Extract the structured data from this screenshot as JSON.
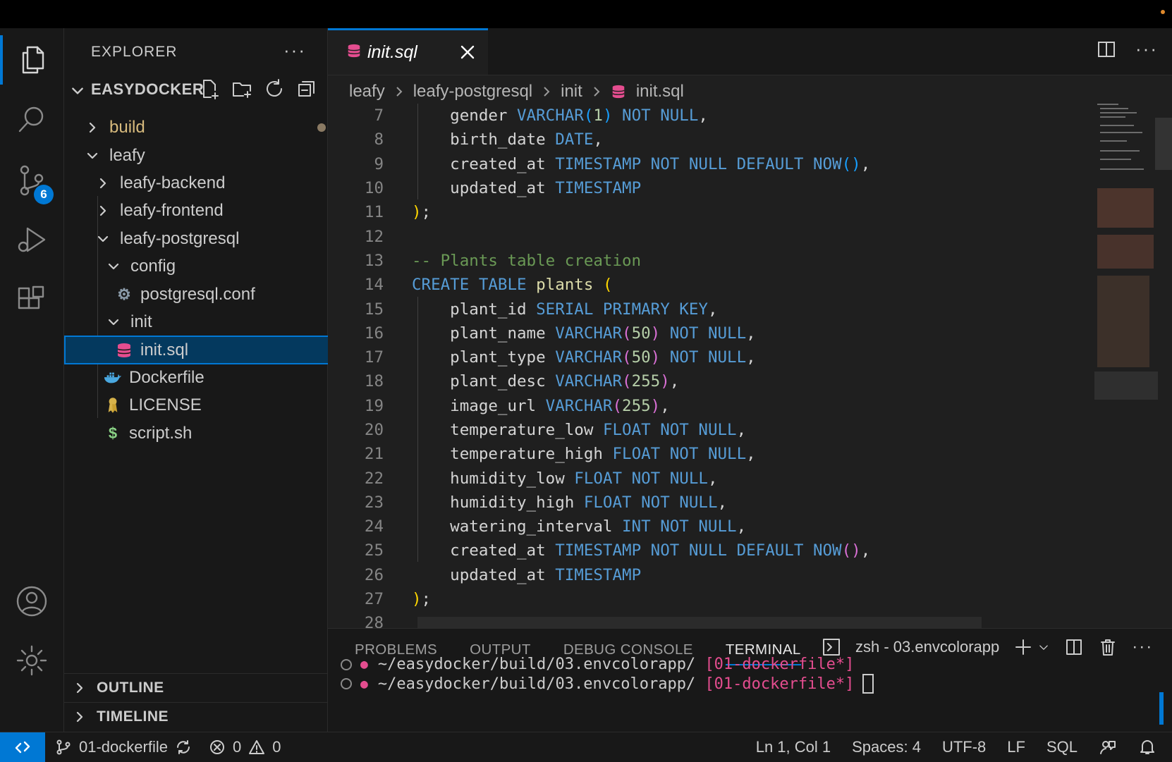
{
  "sidebar": {
    "header": "EXPLORER",
    "project": "EASYDOCKER",
    "tree": [
      {
        "label": "build",
        "type": "folder"
      },
      {
        "label": "leafy",
        "type": "folder"
      },
      {
        "label": "leafy-backend",
        "type": "folder"
      },
      {
        "label": "leafy-frontend",
        "type": "folder"
      },
      {
        "label": "leafy-postgresql",
        "type": "folder"
      },
      {
        "label": "config",
        "type": "folder"
      },
      {
        "label": "postgresql.conf",
        "type": "gear-file"
      },
      {
        "label": "init",
        "type": "folder"
      },
      {
        "label": "init.sql",
        "type": "database-file"
      },
      {
        "label": "Dockerfile",
        "type": "docker-file"
      },
      {
        "label": "LICENSE",
        "type": "license-file"
      },
      {
        "label": "script.sh",
        "type": "shell-file"
      }
    ],
    "outline": "OUTLINE",
    "timeline": "TIMELINE"
  },
  "activity": {
    "source_control_badge": "6"
  },
  "editor": {
    "tab_title": "init.sql",
    "breadcrumb": [
      "leafy",
      "leafy-postgresql",
      "init",
      "init.sql"
    ],
    "line_numbers": [
      "7",
      "8",
      "9",
      "10",
      "11",
      "12",
      "13",
      "14",
      "15",
      "16",
      "17",
      "18",
      "19",
      "20",
      "21",
      "22",
      "23",
      "24",
      "25",
      "26",
      "27",
      "28"
    ]
  },
  "panel": {
    "tabs": [
      "PROBLEMS",
      "OUTPUT",
      "DEBUG CONSOLE",
      "TERMINAL"
    ],
    "terminal_name": "zsh - 03.envcolorapp",
    "terminal_lines": [
      {
        "path": "~/easydocker/build/03.envcolorapp/",
        "branch": "[01-dockerfile*]"
      },
      {
        "path": "~/easydocker/build/03.envcolorapp/",
        "branch": "[01-dockerfile*]"
      }
    ]
  },
  "status": {
    "branch": "01-dockerfile",
    "errors": "0",
    "warnings": "0",
    "position": "Ln 1, Col 1",
    "spaces": "Spaces: 4",
    "encoding": "UTF-8",
    "eol": "LF",
    "language": "SQL"
  },
  "colors": {
    "accent": "#0078d4",
    "keyword": "#569cd6",
    "comment": "#6a9955",
    "db_icon": "#e44d8f"
  }
}
